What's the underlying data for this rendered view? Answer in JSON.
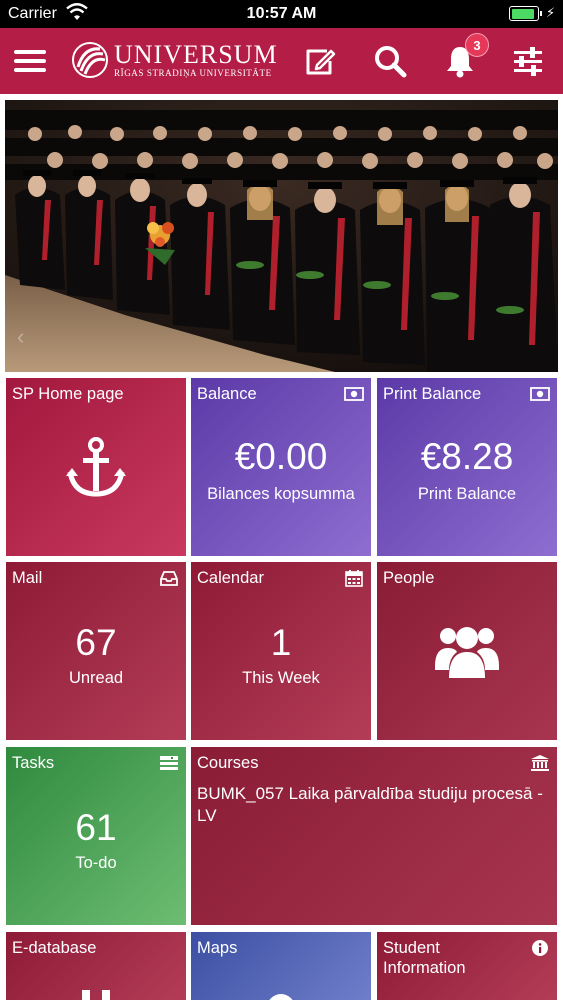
{
  "status_bar": {
    "carrier": "Carrier",
    "time": "10:57 AM",
    "battery_level": 0.9
  },
  "header": {
    "logo_name": "UNIVERSUM",
    "logo_sub": "RĪGAS STRADIŅA UNIVERSITĀTE",
    "notification_count": "3",
    "brand_color": "#b41d45"
  },
  "hero": {
    "icon": "graduation-photo"
  },
  "tiles": {
    "sp_home": {
      "title": "SP Home page",
      "icon": "anchor-icon"
    },
    "balance": {
      "title": "Balance",
      "value": "€0.00",
      "label": "Bilances kopsumma",
      "icon": "money-icon"
    },
    "print_balance": {
      "title": "Print Balance",
      "value": "€8.28",
      "label": "Print Balance",
      "icon": "money-icon"
    },
    "mail": {
      "title": "Mail",
      "value": "67",
      "label": "Unread",
      "icon": "inbox-icon"
    },
    "calendar": {
      "title": "Calendar",
      "value": "1",
      "label": "This Week",
      "icon": "calendar-icon"
    },
    "people": {
      "title": "People",
      "icon": "users-icon"
    },
    "tasks": {
      "title": "Tasks",
      "value": "61",
      "label": "To-do",
      "icon": "list-icon"
    },
    "courses": {
      "title": "Courses",
      "description": "BUMK_057 Laika pārvaldība studiju procesā - LV",
      "icon": "institution-icon"
    },
    "edatabase": {
      "title": "E-database"
    },
    "maps": {
      "title": "Maps"
    },
    "student_info": {
      "title": "Student Information",
      "icon": "info-icon"
    }
  }
}
